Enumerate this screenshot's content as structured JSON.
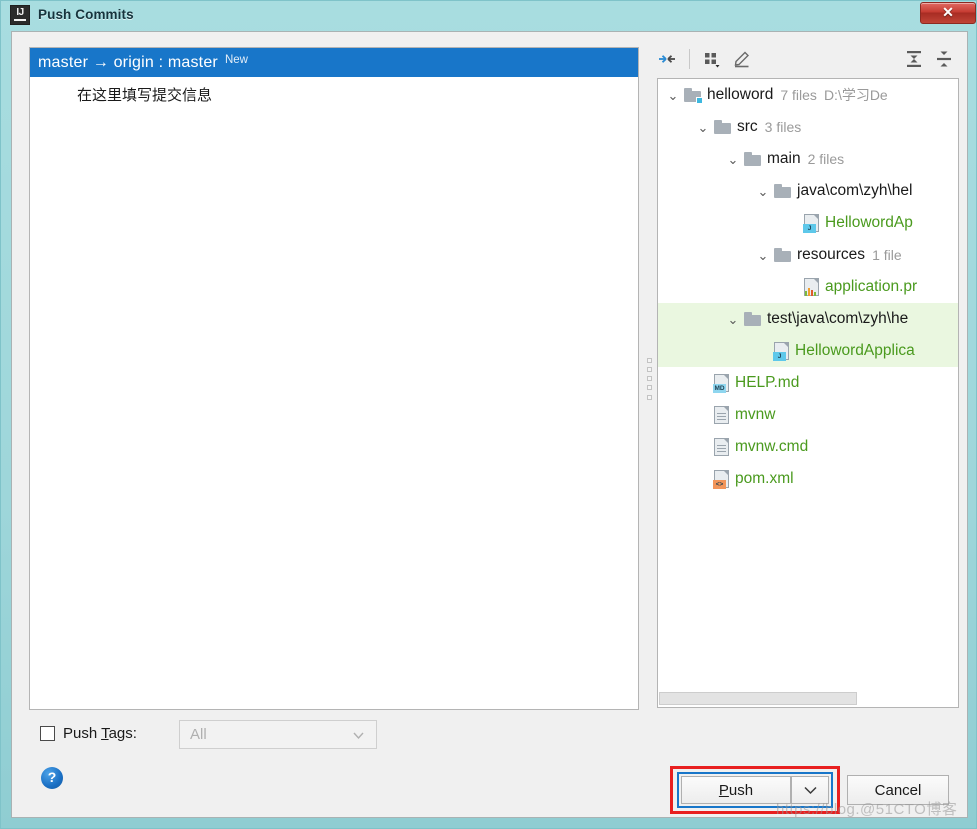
{
  "window": {
    "title": "Push Commits",
    "app_icon": "intellij-idea-icon",
    "close_label": "✕",
    "chrome_color": "#9ed6da"
  },
  "commit_panel": {
    "branch_row": {
      "source": "master",
      "arrow": "→",
      "target": "origin : master",
      "full_label": "master → origin : master",
      "badge": "New",
      "selected_color": "#1876c9"
    },
    "commit_message": "在这里填写提交信息"
  },
  "tree_toolbar": {
    "buttons": [
      {
        "name": "collapse-selection-icon",
        "tooltip": "Collapse"
      },
      {
        "name": "group-by-icon",
        "tooltip": "Group By"
      },
      {
        "name": "edit-pencil-icon",
        "tooltip": "Edit"
      },
      {
        "name": "expand-all-icon",
        "tooltip": "Expand All"
      },
      {
        "name": "collapse-all-icon",
        "tooltip": "Collapse All"
      }
    ]
  },
  "tree": {
    "rows": [
      {
        "indent": 0,
        "chevron": "⌄",
        "icon": "module-folder-icon",
        "name": "helloword",
        "meta": "7 files",
        "path": "D:\\学习De",
        "kind": "folder",
        "selected": false
      },
      {
        "indent": 1,
        "chevron": "⌄",
        "icon": "folder-icon",
        "name": "src",
        "meta": "3 files",
        "path": "",
        "kind": "folder",
        "selected": false
      },
      {
        "indent": 2,
        "chevron": "⌄",
        "icon": "folder-icon",
        "name": "main",
        "meta": "2 files",
        "path": "",
        "kind": "folder",
        "selected": false
      },
      {
        "indent": 3,
        "chevron": "⌄",
        "icon": "folder-icon",
        "name": "java\\com\\zyh\\hel",
        "meta": "",
        "path": "",
        "kind": "folder",
        "selected": false
      },
      {
        "indent": 4,
        "chevron": "",
        "icon": "java-file-icon",
        "name": "HellowordAp",
        "meta": "",
        "path": "",
        "kind": "file",
        "badge": "J",
        "selected": false
      },
      {
        "indent": 3,
        "chevron": "⌄",
        "icon": "folder-icon",
        "name": "resources",
        "meta": "1 file",
        "path": "",
        "kind": "folder",
        "selected": false
      },
      {
        "indent": 4,
        "chevron": "",
        "icon": "properties-file-icon",
        "name": "application.pr",
        "meta": "",
        "path": "",
        "kind": "file",
        "badge": "",
        "selected": false
      },
      {
        "indent": 2,
        "chevron": "⌄",
        "icon": "folder-icon",
        "name": "test\\java\\com\\zyh\\he",
        "meta": "",
        "path": "",
        "kind": "folder",
        "selected": true
      },
      {
        "indent": 3,
        "chevron": "",
        "icon": "java-file-icon",
        "name": "HellowordApplica",
        "meta": "",
        "path": "",
        "kind": "file",
        "badge": "J",
        "selected": true
      },
      {
        "indent": 1,
        "chevron": "",
        "icon": "markdown-file-icon",
        "name": "HELP.md",
        "meta": "",
        "path": "",
        "kind": "file",
        "badge": "MD",
        "selected": false
      },
      {
        "indent": 1,
        "chevron": "",
        "icon": "text-file-icon",
        "name": "mvnw",
        "meta": "",
        "path": "",
        "kind": "file",
        "badge": "",
        "selected": false
      },
      {
        "indent": 1,
        "chevron": "",
        "icon": "text-file-icon",
        "name": "mvnw.cmd",
        "meta": "",
        "path": "",
        "kind": "file",
        "badge": "",
        "selected": false
      },
      {
        "indent": 1,
        "chevron": "",
        "icon": "xml-file-icon",
        "name": "pom.xml",
        "meta": "",
        "path": "",
        "kind": "file",
        "badge": "<>",
        "selected": false
      }
    ],
    "selection_color": "#eaf7e0",
    "file_text_color": "#4a9a1e"
  },
  "footer": {
    "push_tags_label_pre": "Push ",
    "push_tags_label_mnemonic": "T",
    "push_tags_label_post": "ags:",
    "push_tags_checked": false,
    "tags_combo_value": "All",
    "help_glyph": "?"
  },
  "actions": {
    "push_label_pre": "",
    "push_label_mnemonic": "P",
    "push_label_post": "ush",
    "push_dropdown_glyph": "⌄",
    "cancel_label": "Cancel",
    "highlight_color": "#e81f1f",
    "focus_color": "#1876c9"
  },
  "watermark": "https://blog.@51CTO博客"
}
